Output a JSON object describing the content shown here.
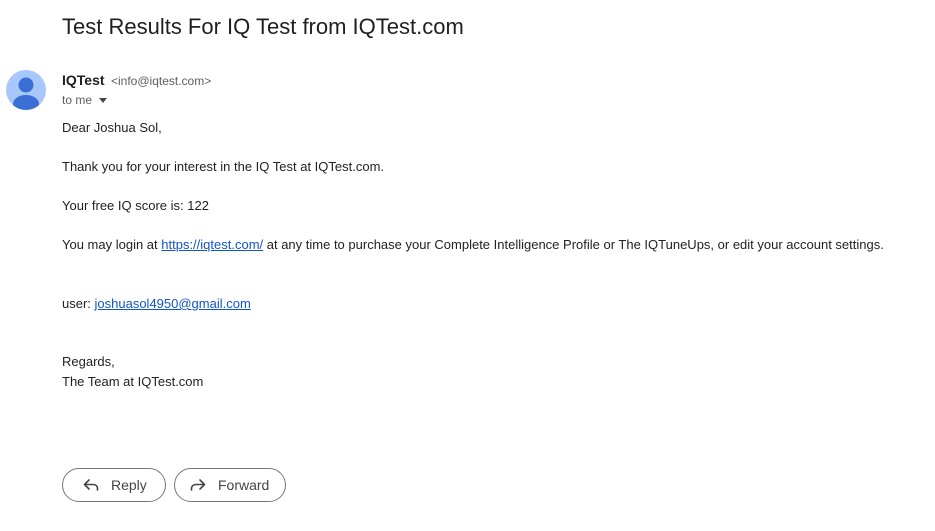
{
  "email": {
    "subject": "Test Results For IQ Test from IQTest.com",
    "sender_name": "IQTest",
    "sender_email": "<info@iqtest.com>",
    "recipient": "to me",
    "body": {
      "greeting": "Dear Joshua Sol,",
      "line1": "Thank you for your interest in the IQ Test at IQTest.com.",
      "line2": "Your free IQ score is: 122",
      "line3_prefix": "You may login at ",
      "line3_link": "https://iqtest.com/",
      "line3_suffix": " at any time to purchase your Complete Intelligence Profile or The IQTuneUps, or edit your account settings.",
      "user_label": "user: ",
      "user_email": "joshuasol4950@gmail.com",
      "regards": "Regards,",
      "signature": "The Team at IQTest.com"
    }
  },
  "actions": {
    "reply_label": "Reply",
    "forward_label": "Forward"
  },
  "icons": {
    "avatar": "person-avatar-icon",
    "recipients_dropdown": "caret-down-icon",
    "reply": "reply-arrow-icon",
    "forward": "forward-arrow-icon"
  },
  "colors": {
    "link": "#1155cc",
    "avatar_bg": "#a8c7fa",
    "avatar_fg": "#3b6fd6"
  }
}
